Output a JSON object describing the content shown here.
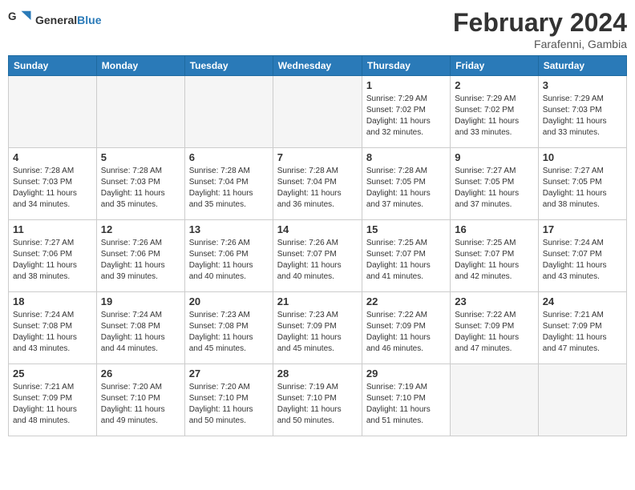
{
  "header": {
    "logo_text_general": "General",
    "logo_text_blue": "Blue",
    "month_year": "February 2024",
    "location": "Farafenni, Gambia"
  },
  "days_of_week": [
    "Sunday",
    "Monday",
    "Tuesday",
    "Wednesday",
    "Thursday",
    "Friday",
    "Saturday"
  ],
  "weeks": [
    [
      {
        "day": "",
        "info": ""
      },
      {
        "day": "",
        "info": ""
      },
      {
        "day": "",
        "info": ""
      },
      {
        "day": "",
        "info": ""
      },
      {
        "day": "1",
        "info": "Sunrise: 7:29 AM\nSunset: 7:02 PM\nDaylight: 11 hours\nand 32 minutes."
      },
      {
        "day": "2",
        "info": "Sunrise: 7:29 AM\nSunset: 7:02 PM\nDaylight: 11 hours\nand 33 minutes."
      },
      {
        "day": "3",
        "info": "Sunrise: 7:29 AM\nSunset: 7:03 PM\nDaylight: 11 hours\nand 33 minutes."
      }
    ],
    [
      {
        "day": "4",
        "info": "Sunrise: 7:28 AM\nSunset: 7:03 PM\nDaylight: 11 hours\nand 34 minutes."
      },
      {
        "day": "5",
        "info": "Sunrise: 7:28 AM\nSunset: 7:03 PM\nDaylight: 11 hours\nand 35 minutes."
      },
      {
        "day": "6",
        "info": "Sunrise: 7:28 AM\nSunset: 7:04 PM\nDaylight: 11 hours\nand 35 minutes."
      },
      {
        "day": "7",
        "info": "Sunrise: 7:28 AM\nSunset: 7:04 PM\nDaylight: 11 hours\nand 36 minutes."
      },
      {
        "day": "8",
        "info": "Sunrise: 7:28 AM\nSunset: 7:05 PM\nDaylight: 11 hours\nand 37 minutes."
      },
      {
        "day": "9",
        "info": "Sunrise: 7:27 AM\nSunset: 7:05 PM\nDaylight: 11 hours\nand 37 minutes."
      },
      {
        "day": "10",
        "info": "Sunrise: 7:27 AM\nSunset: 7:05 PM\nDaylight: 11 hours\nand 38 minutes."
      }
    ],
    [
      {
        "day": "11",
        "info": "Sunrise: 7:27 AM\nSunset: 7:06 PM\nDaylight: 11 hours\nand 38 minutes."
      },
      {
        "day": "12",
        "info": "Sunrise: 7:26 AM\nSunset: 7:06 PM\nDaylight: 11 hours\nand 39 minutes."
      },
      {
        "day": "13",
        "info": "Sunrise: 7:26 AM\nSunset: 7:06 PM\nDaylight: 11 hours\nand 40 minutes."
      },
      {
        "day": "14",
        "info": "Sunrise: 7:26 AM\nSunset: 7:07 PM\nDaylight: 11 hours\nand 40 minutes."
      },
      {
        "day": "15",
        "info": "Sunrise: 7:25 AM\nSunset: 7:07 PM\nDaylight: 11 hours\nand 41 minutes."
      },
      {
        "day": "16",
        "info": "Sunrise: 7:25 AM\nSunset: 7:07 PM\nDaylight: 11 hours\nand 42 minutes."
      },
      {
        "day": "17",
        "info": "Sunrise: 7:24 AM\nSunset: 7:07 PM\nDaylight: 11 hours\nand 43 minutes."
      }
    ],
    [
      {
        "day": "18",
        "info": "Sunrise: 7:24 AM\nSunset: 7:08 PM\nDaylight: 11 hours\nand 43 minutes."
      },
      {
        "day": "19",
        "info": "Sunrise: 7:24 AM\nSunset: 7:08 PM\nDaylight: 11 hours\nand 44 minutes."
      },
      {
        "day": "20",
        "info": "Sunrise: 7:23 AM\nSunset: 7:08 PM\nDaylight: 11 hours\nand 45 minutes."
      },
      {
        "day": "21",
        "info": "Sunrise: 7:23 AM\nSunset: 7:09 PM\nDaylight: 11 hours\nand 45 minutes."
      },
      {
        "day": "22",
        "info": "Sunrise: 7:22 AM\nSunset: 7:09 PM\nDaylight: 11 hours\nand 46 minutes."
      },
      {
        "day": "23",
        "info": "Sunrise: 7:22 AM\nSunset: 7:09 PM\nDaylight: 11 hours\nand 47 minutes."
      },
      {
        "day": "24",
        "info": "Sunrise: 7:21 AM\nSunset: 7:09 PM\nDaylight: 11 hours\nand 47 minutes."
      }
    ],
    [
      {
        "day": "25",
        "info": "Sunrise: 7:21 AM\nSunset: 7:09 PM\nDaylight: 11 hours\nand 48 minutes."
      },
      {
        "day": "26",
        "info": "Sunrise: 7:20 AM\nSunset: 7:10 PM\nDaylight: 11 hours\nand 49 minutes."
      },
      {
        "day": "27",
        "info": "Sunrise: 7:20 AM\nSunset: 7:10 PM\nDaylight: 11 hours\nand 50 minutes."
      },
      {
        "day": "28",
        "info": "Sunrise: 7:19 AM\nSunset: 7:10 PM\nDaylight: 11 hours\nand 50 minutes."
      },
      {
        "day": "29",
        "info": "Sunrise: 7:19 AM\nSunset: 7:10 PM\nDaylight: 11 hours\nand 51 minutes."
      },
      {
        "day": "",
        "info": ""
      },
      {
        "day": "",
        "info": ""
      }
    ]
  ]
}
